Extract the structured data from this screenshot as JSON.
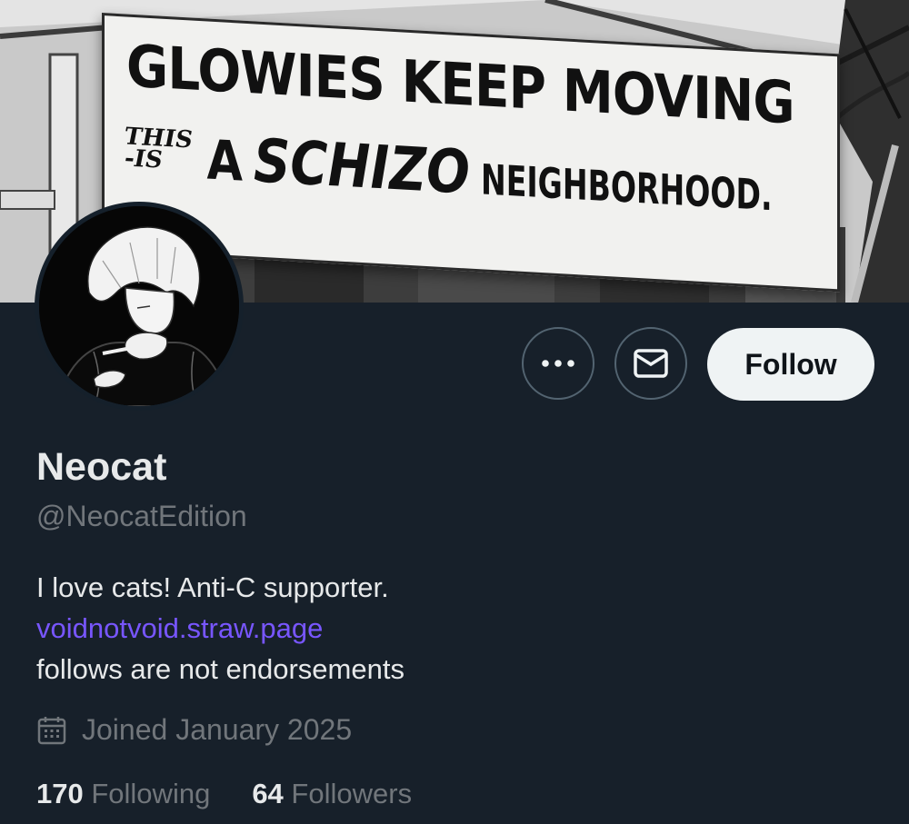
{
  "banner": {
    "sign_line1": "GLOWIES KEEP MOVING",
    "sign_small_1": "THIS",
    "sign_small_2": "-IS",
    "sign_a": "A",
    "sign_schizo": "SCHIZO",
    "sign_neighborhood": "NEIGHBORHOOD."
  },
  "actions": {
    "more_icon": "more-horizontal-icon",
    "message_icon": "envelope-icon",
    "follow_label": "Follow"
  },
  "profile": {
    "name": "Neocat",
    "handle": "@NeocatEdition",
    "bio_line1": "I love cats! Anti-C supporter.",
    "bio_link": "voidnotvoid.straw.page",
    "bio_line3": "follows are not endorsements",
    "joined_icon": "calendar-icon",
    "joined": "Joined January 2025"
  },
  "stats": {
    "following_count": "170",
    "following_label": "Following",
    "followers_count": "64",
    "followers_label": "Followers"
  },
  "colors": {
    "background": "#17202a",
    "primary_text": "#e7e9ea",
    "secondary_text": "#71767b",
    "link": "#7856ff",
    "follow_button_bg": "#eff3f4",
    "button_border": "#536471"
  }
}
